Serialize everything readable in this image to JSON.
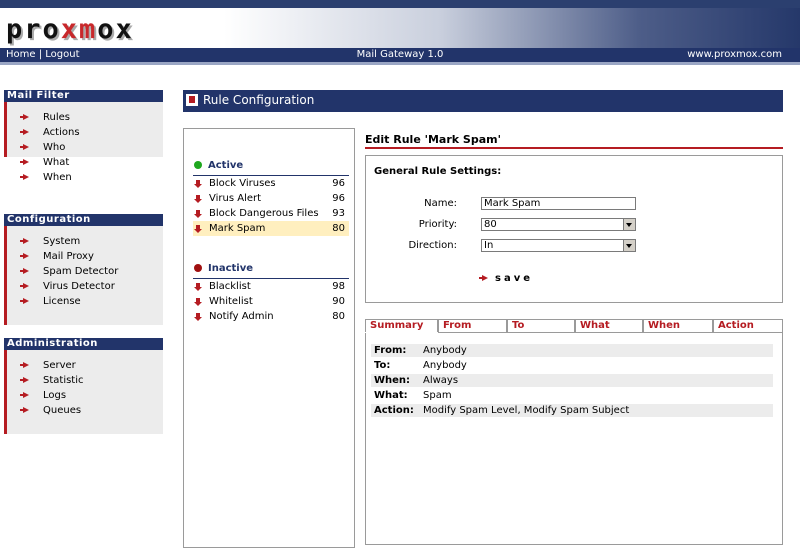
{
  "header": {
    "logo": {
      "pre": "pro",
      "mid": "xm",
      "post": "ox"
    },
    "nav": {
      "home": "Home",
      "sep": "|",
      "logout": "Logout"
    },
    "app_title": "Mail Gateway 1.0",
    "site": "www.proxmox.com"
  },
  "sidebar": [
    {
      "title": "Mail Filter",
      "items": [
        "Rules",
        "Actions",
        "Who",
        "What",
        "When"
      ]
    },
    {
      "title": "Configuration",
      "items": [
        "System",
        "Mail Proxy",
        "Spam Detector",
        "Virus Detector",
        "License"
      ]
    },
    {
      "title": "Administration",
      "items": [
        "Server",
        "Statistic",
        "Logs",
        "Queues"
      ]
    }
  ],
  "page_title": "Rule Configuration",
  "rules": {
    "active_label": "Active",
    "active": [
      {
        "name": "Block Viruses",
        "priority": "96"
      },
      {
        "name": "Virus Alert",
        "priority": "96"
      },
      {
        "name": "Block Dangerous Files",
        "priority": "93"
      },
      {
        "name": "Mark Spam",
        "priority": "80"
      }
    ],
    "inactive_label": "Inactive",
    "inactive": [
      {
        "name": "Blacklist",
        "priority": "98"
      },
      {
        "name": "Whitelist",
        "priority": "90"
      },
      {
        "name": "Notify Admin",
        "priority": "80"
      }
    ],
    "selected": "Mark Spam"
  },
  "edit": {
    "title": "Edit Rule 'Mark Spam'",
    "section": "General Rule Settings:",
    "name_label": "Name:",
    "name_value": "Mark Spam",
    "priority_label": "Priority:",
    "priority_value": "80",
    "direction_label": "Direction:",
    "direction_value": "In",
    "save_label": "save"
  },
  "tabs": [
    "Summary",
    "From",
    "To",
    "What",
    "When",
    "Action"
  ],
  "active_tab": "Summary",
  "summary": [
    {
      "key": "From:",
      "value": "Anybody"
    },
    {
      "key": "To:",
      "value": "Anybody"
    },
    {
      "key": "When:",
      "value": "Always"
    },
    {
      "key": "What:",
      "value": "Spam"
    },
    {
      "key": "Action:",
      "value": "Modify Spam Level, Modify Spam Subject"
    }
  ],
  "colors": {
    "navy": "#22346a",
    "accent": "#b51c22",
    "selected_row": "#ffefbf"
  }
}
